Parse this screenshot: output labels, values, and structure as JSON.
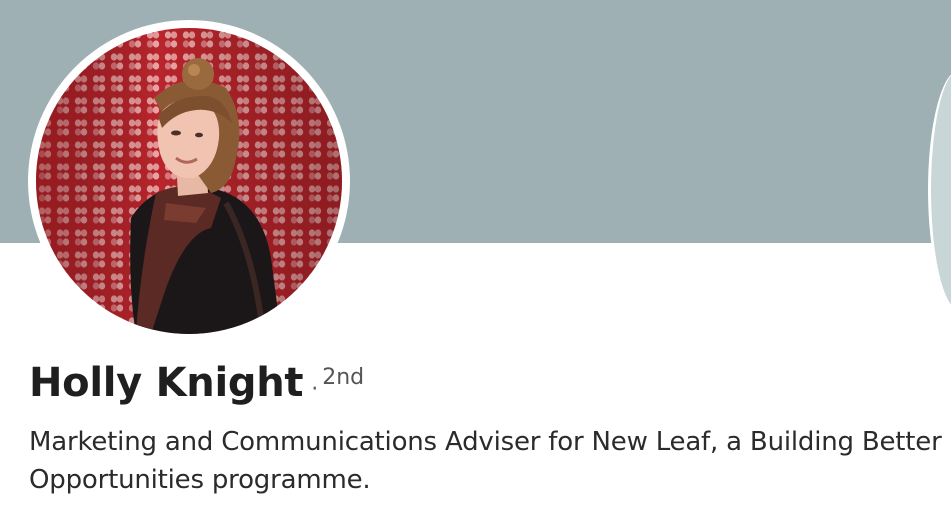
{
  "profile": {
    "name": "Holly Knight",
    "degree_separator": "·",
    "connection_degree": "2nd",
    "headline": "Marketing and Communications Adviser for New Leaf, a Building Better Opportunities programme."
  },
  "colors": {
    "cover_background": "#9fb0b4",
    "photo_wall": "#c2353a",
    "text_primary": "#1f1f1f"
  },
  "icons": {
    "avatar": "profile-photo"
  }
}
